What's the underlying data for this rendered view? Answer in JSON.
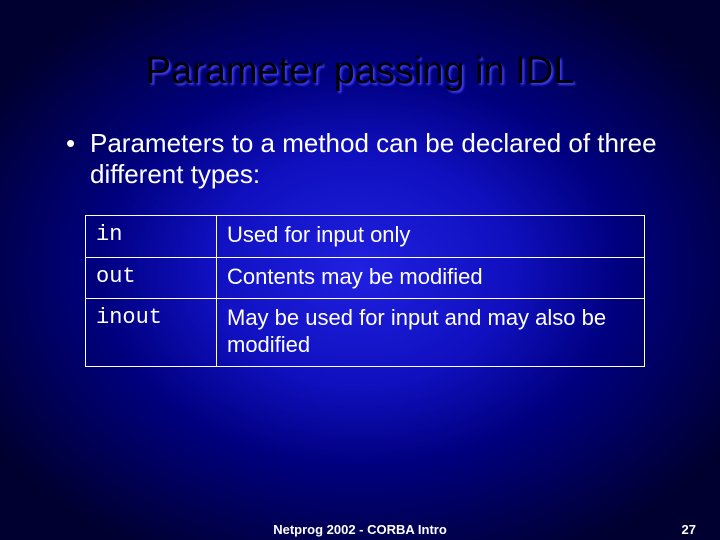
{
  "title": "Parameter passing in IDL",
  "bullet": "Parameters to a method can be declared of three different types:",
  "rows": [
    {
      "kw": "in",
      "desc": "Used for input only"
    },
    {
      "kw": "out",
      "desc": "Contents may be modified"
    },
    {
      "kw": "inout",
      "desc": "May be used for input and may also be modified"
    }
  ],
  "footer": {
    "center": "Netprog 2002  -  CORBA Intro",
    "page": "27"
  }
}
